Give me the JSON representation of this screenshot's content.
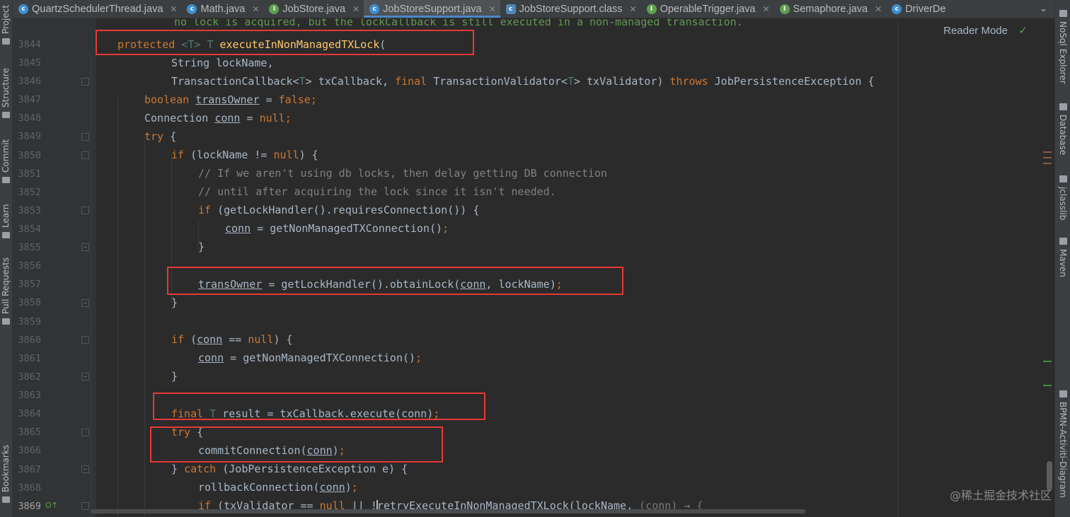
{
  "left_tools": [
    {
      "label": "Project",
      "icon": "folder-icon"
    },
    {
      "label": "Structure",
      "icon": "structure-icon"
    },
    {
      "label": "Commit",
      "icon": "commit-icon"
    },
    {
      "label": "Learn",
      "icon": "learn-icon"
    },
    {
      "label": "Pull Requests",
      "icon": "pull-request-icon"
    },
    {
      "label": "Bookmarks",
      "icon": "bookmark-icon"
    }
  ],
  "right_tools": [
    {
      "label": "NoSql Explorer",
      "icon": "nosql-icon"
    },
    {
      "label": "Database",
      "icon": "database-icon"
    },
    {
      "label": "jclasslib",
      "icon": "jclasslib-icon"
    },
    {
      "label": "Maven",
      "icon": "maven-icon"
    },
    {
      "label": "BPMN-Activiti-Diagram",
      "icon": "bpmn-icon"
    }
  ],
  "tabs": [
    {
      "label": "QuartzSchedulerThread.java",
      "icon": "c",
      "active": false
    },
    {
      "label": "Math.java",
      "icon": "c",
      "active": false
    },
    {
      "label": "JobStore.java",
      "icon": "i",
      "active": false
    },
    {
      "label": "JobStoreSupport.java",
      "icon": "c",
      "active": true
    },
    {
      "label": "JobStoreSupport.class",
      "icon": "cls",
      "active": false
    },
    {
      "label": "OperableTrigger.java",
      "icon": "i",
      "active": false
    },
    {
      "label": "Semaphore.java",
      "icon": "c",
      "active": false
    },
    {
      "label": "DriverDe",
      "icon": "c",
      "active": false
    }
  ],
  "editor": {
    "reader_mode": "Reader Mode",
    "check_mark": "✓",
    "top_doc": "no lock is acquired, but the lockCallback is still executed in a non-managed transaction.",
    "line_numbers": [
      "3844",
      "3845",
      "3846",
      "3847",
      "3848",
      "3849",
      "3850",
      "3851",
      "3852",
      "3853",
      "3854",
      "3855",
      "3856",
      "3857",
      "3858",
      "3859",
      "3860",
      "3861",
      "3862",
      "3863",
      "3864",
      "3865",
      "3866",
      "3867",
      "3868",
      "3869"
    ],
    "gutter_marks": {
      "line": "3869",
      "text": "O↑"
    },
    "lines": {
      "l3844": [
        "protected ",
        "<T> ",
        "T ",
        "executeInNonManagedTXLock",
        "("
      ],
      "l3845": "String lockName,",
      "l3846": [
        "TransactionCallback<",
        "T",
        "> txCallback, ",
        "final ",
        "TransactionValidator<",
        "T",
        "> txValidator) ",
        "throws ",
        "JobPersistenceException {"
      ],
      "l3847": [
        "boolean ",
        "transOwner",
        " = ",
        "false",
        ";"
      ],
      "l3848": [
        "Connection ",
        "conn",
        " = ",
        "null",
        ";"
      ],
      "l3849": [
        "try ",
        "{"
      ],
      "l3850": [
        "if ",
        "(lockName != ",
        "null",
        ") {"
      ],
      "l3851": "// If we aren't using db locks, then delay getting DB connection",
      "l3852": "// until after acquiring the lock since it isn't needed.",
      "l3853": [
        "if ",
        "(getLockHandler().requiresConnection()) {"
      ],
      "l3854": [
        "conn",
        " = getNonManagedTXConnection()",
        ";"
      ],
      "l3855": "}",
      "l3857": [
        "transOwner",
        " = getLockHandler().obtainLock(",
        "conn",
        ", lockName)",
        ";"
      ],
      "l3858": "}",
      "l3860": [
        "if ",
        "(",
        "conn",
        " == ",
        "null",
        ") {"
      ],
      "l3861": [
        "conn",
        " = getNonManagedTXConnection()",
        ";"
      ],
      "l3862": "}",
      "l3864": [
        "final ",
        "T ",
        "result = txCallback.execute(conn)",
        ";"
      ],
      "l3865": [
        "try ",
        "{"
      ],
      "l3866": [
        "commitConnection(",
        "conn",
        ")",
        ";"
      ],
      "l3867": [
        "} ",
        "catch ",
        "(JobPersistenceException e) {"
      ],
      "l3868": [
        "rollbackConnection(",
        "conn",
        ")",
        ";"
      ],
      "l3869": [
        "if ",
        "(txValidator == ",
        "null ",
        "|| !",
        "retryExecuteInNonManagedTXLock(lockName, ",
        "(conn) → {"
      ]
    }
  },
  "watermark": "@稀土掘金技术社区",
  "colors": {
    "highlight_box": "#e53935",
    "keyword": "#cc7832",
    "function": "#ffc66d",
    "comment": "#808080"
  }
}
